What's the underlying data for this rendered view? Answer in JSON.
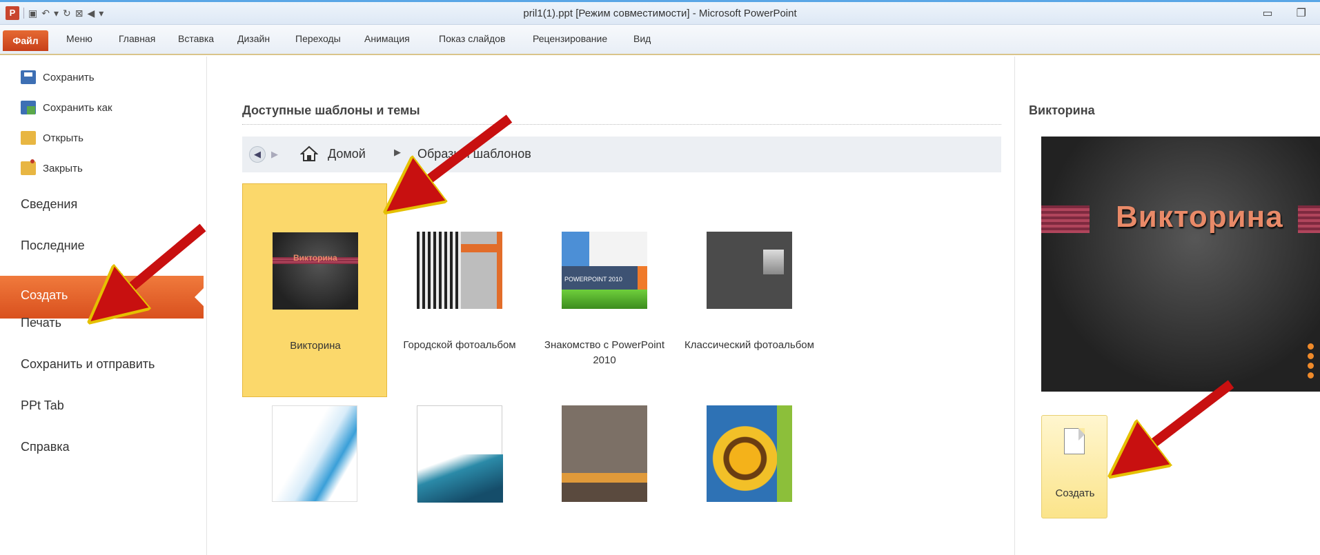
{
  "window": {
    "title": "pril1(1).ppt [Режим совместимости]  -  Microsoft PowerPoint",
    "app_icon": "P"
  },
  "ribbon": {
    "file": "Файл",
    "tabs": [
      "Меню",
      "Главная",
      "Вставка",
      "Дизайн",
      "Переходы",
      "Анимация",
      "Показ слайдов",
      "Рецензирование",
      "Вид"
    ]
  },
  "leftnav": {
    "small": [
      "Сохранить",
      "Сохранить как",
      "Открыть",
      "Закрыть"
    ],
    "big": [
      "Сведения",
      "Последние",
      "Создать",
      "Печать",
      "Сохранить и отправить",
      "PPt Tab",
      "Справка"
    ],
    "active": "Создать"
  },
  "center": {
    "title": "Доступные шаблоны и темы",
    "breadcrumb": {
      "home": "Домой",
      "path": "Образцы шаблонов"
    },
    "templates": [
      {
        "label": "Викторина",
        "selected": true,
        "thumb_title": "Викторина"
      },
      {
        "label": "Городской фотоальбом",
        "selected": false
      },
      {
        "label": "Знакомство с PowerPoint 2010",
        "selected": false,
        "thumb_title": "POWERPOINT 2010"
      },
      {
        "label": "Классический фотоальбом",
        "selected": false
      }
    ]
  },
  "right": {
    "title": "Викторина",
    "preview_title": "Викторина",
    "create_label": "Создать"
  },
  "colors": {
    "file_tab": "#d9501e",
    "active_nav": "#e8652c",
    "selected_tile": "#fbd86b",
    "arrow": "#d01010"
  }
}
